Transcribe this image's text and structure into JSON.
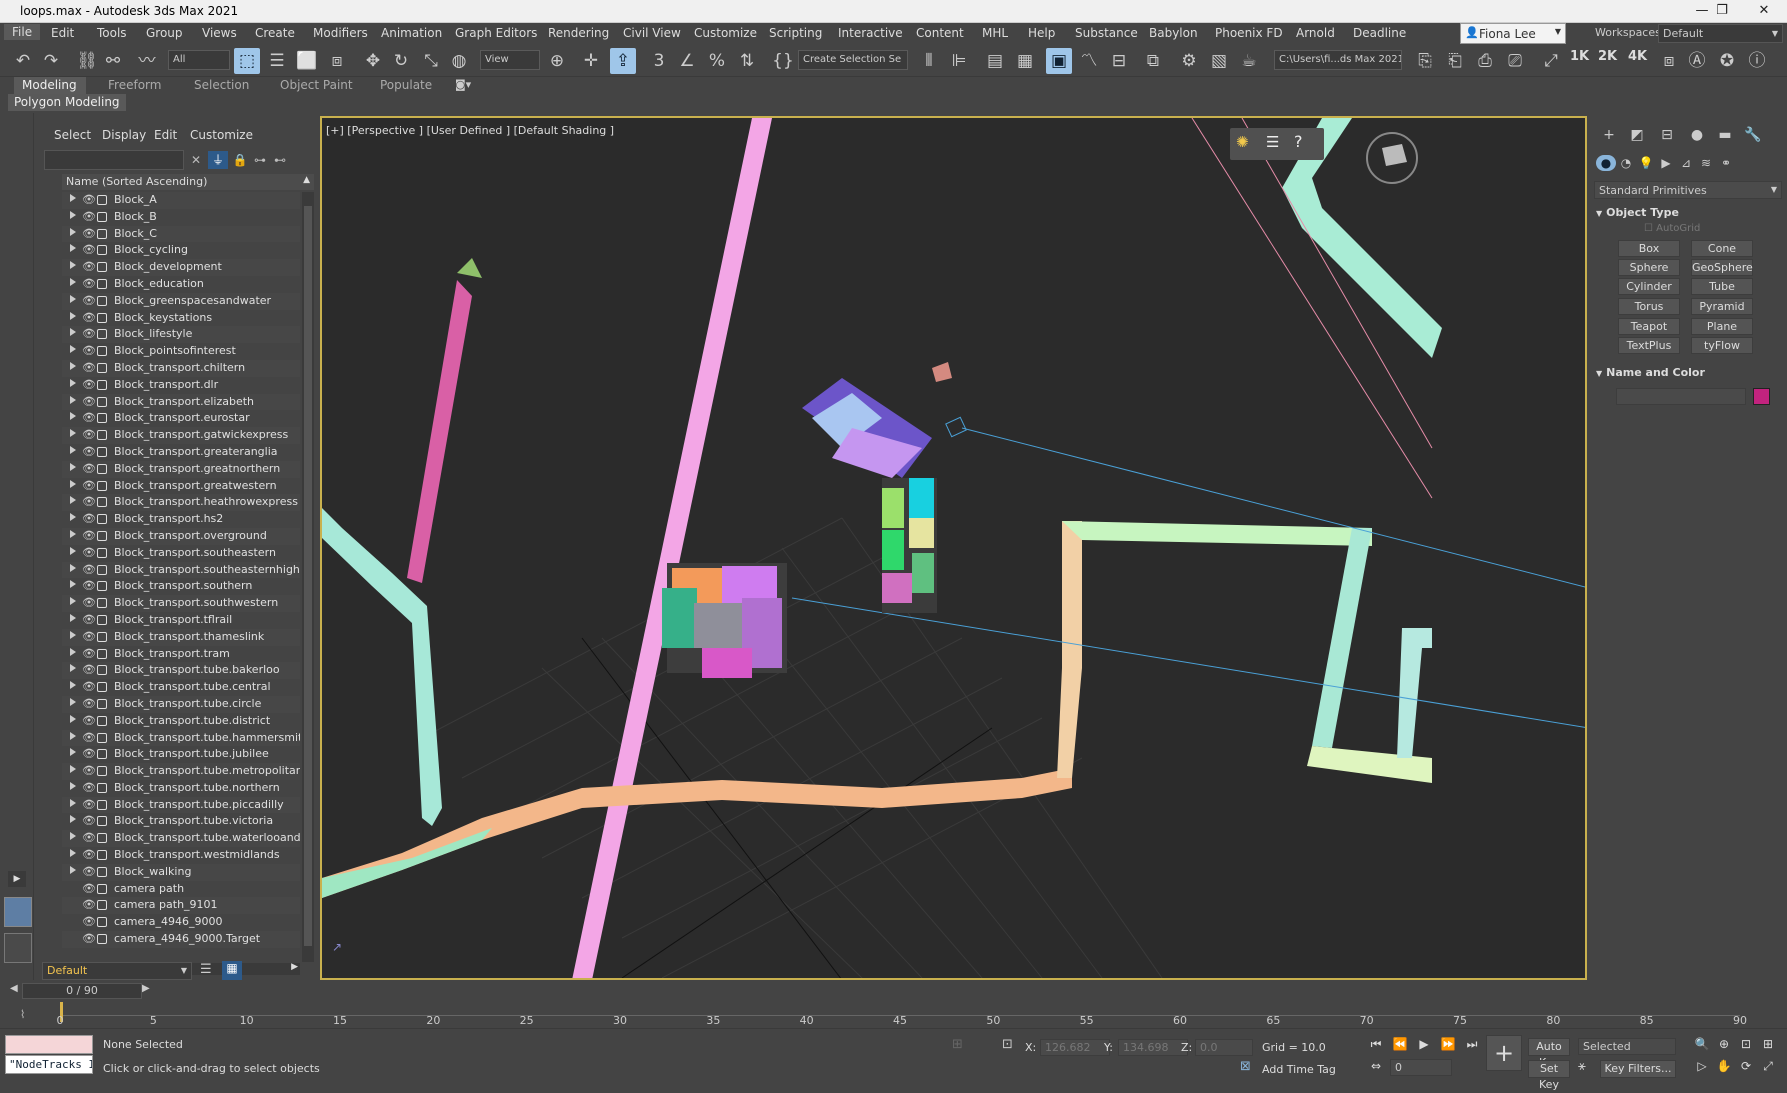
{
  "window": {
    "title": "loops.max - Autodesk 3ds Max 2021",
    "minimize": "—",
    "maximize": "❐",
    "close": "✕"
  },
  "menu": [
    "File",
    "Edit",
    "Tools",
    "Group",
    "Views",
    "Create",
    "Modifiers",
    "Animation",
    "Graph Editors",
    "Rendering",
    "Civil View",
    "Customize",
    "Scripting",
    "Interactive",
    "Content",
    "MHL",
    "Help",
    "Substance",
    "Babylon",
    "Phoenix FD",
    "Arnold",
    "Deadline"
  ],
  "user": {
    "name": "Fiona Lee"
  },
  "workspace": {
    "label": "Workspaces:",
    "value": "Default"
  },
  "toolbar": {
    "filter": "All",
    "view": "View",
    "selection_set": "Create Selection Se",
    "project_path": "C:\\Users\\fi...ds Max 2021",
    "res_1k": "1K",
    "res_2k": "2K",
    "res_4k": "4K"
  },
  "ribbon": {
    "tabs": [
      "Modeling",
      "Freeform",
      "Selection",
      "Object Paint",
      "Populate"
    ],
    "active": "Modeling",
    "panel": "Polygon Modeling"
  },
  "scene_explorer": {
    "menu": [
      "Select",
      "Display",
      "Edit",
      "Customize"
    ],
    "column": "Name (Sorted Ascending)",
    "layer": "Default",
    "items": [
      "Block_A",
      "Block_B",
      "Block_C",
      "Block_cycling",
      "Block_development",
      "Block_education",
      "Block_greenspacesandwater",
      "Block_keystations",
      "Block_lifestyle",
      "Block_pointsofinterest",
      "Block_transport.chiltern",
      "Block_transport.dlr",
      "Block_transport.elizabeth",
      "Block_transport.eurostar",
      "Block_transport.gatwickexpress",
      "Block_transport.greateranglia",
      "Block_transport.greatnorthern",
      "Block_transport.greatwestern",
      "Block_transport.heathrowexpress",
      "Block_transport.hs2",
      "Block_transport.overground",
      "Block_transport.southeastern",
      "Block_transport.southeasternhighspeed",
      "Block_transport.southern",
      "Block_transport.southwestern",
      "Block_transport.tflrail",
      "Block_transport.thameslink",
      "Block_transport.tram",
      "Block_transport.tube.bakerloo",
      "Block_transport.tube.central",
      "Block_transport.tube.circle",
      "Block_transport.tube.district",
      "Block_transport.tube.hammersmithandcit",
      "Block_transport.tube.jubilee",
      "Block_transport.tube.metropolitan",
      "Block_transport.tube.northern",
      "Block_transport.tube.piccadilly",
      "Block_transport.tube.victoria",
      "Block_transport.tube.waterlooandcity",
      "Block_transport.westmidlands",
      "Block_walking",
      "camera path",
      "camera path_9101",
      "camera_4946_9000",
      "camera_4946_9000.Target"
    ]
  },
  "viewport": {
    "label": "[+] [Perspective ] [User Defined ] [Default Shading ]"
  },
  "command_panel": {
    "category": "Standard Primitives",
    "object_type": "Object Type",
    "autogrid": "AutoGrid",
    "buttons": [
      "Box",
      "Cone",
      "Sphere",
      "GeoSphere",
      "Cylinder",
      "Tube",
      "Torus",
      "Pyramid",
      "Teapot",
      "Plane",
      "TextPlus",
      "tyFlow"
    ],
    "name_and_color": "Name and Color",
    "color": "#c2237e"
  },
  "time": {
    "slider": "0 / 90",
    "ticks": [
      0,
      5,
      10,
      15,
      20,
      25,
      30,
      35,
      40,
      45,
      50,
      55,
      60,
      65,
      70,
      75,
      80,
      85,
      90
    ]
  },
  "status": {
    "selection": "None Selected",
    "prompt": "Click or click-and-drag to select objects",
    "maxscript": "\"NodeTracks I",
    "x_label": "X:",
    "x": "126.682",
    "y_label": "Y:",
    "y": "134.698",
    "z_label": "Z:",
    "z": "0.0",
    "grid": "Grid = 10.0",
    "add_time_tag": "Add Time Tag",
    "auto_key": "Auto Key",
    "set_key": "Set Key",
    "selected": "Selected",
    "key_filters": "Key Filters...",
    "frame": "0"
  }
}
